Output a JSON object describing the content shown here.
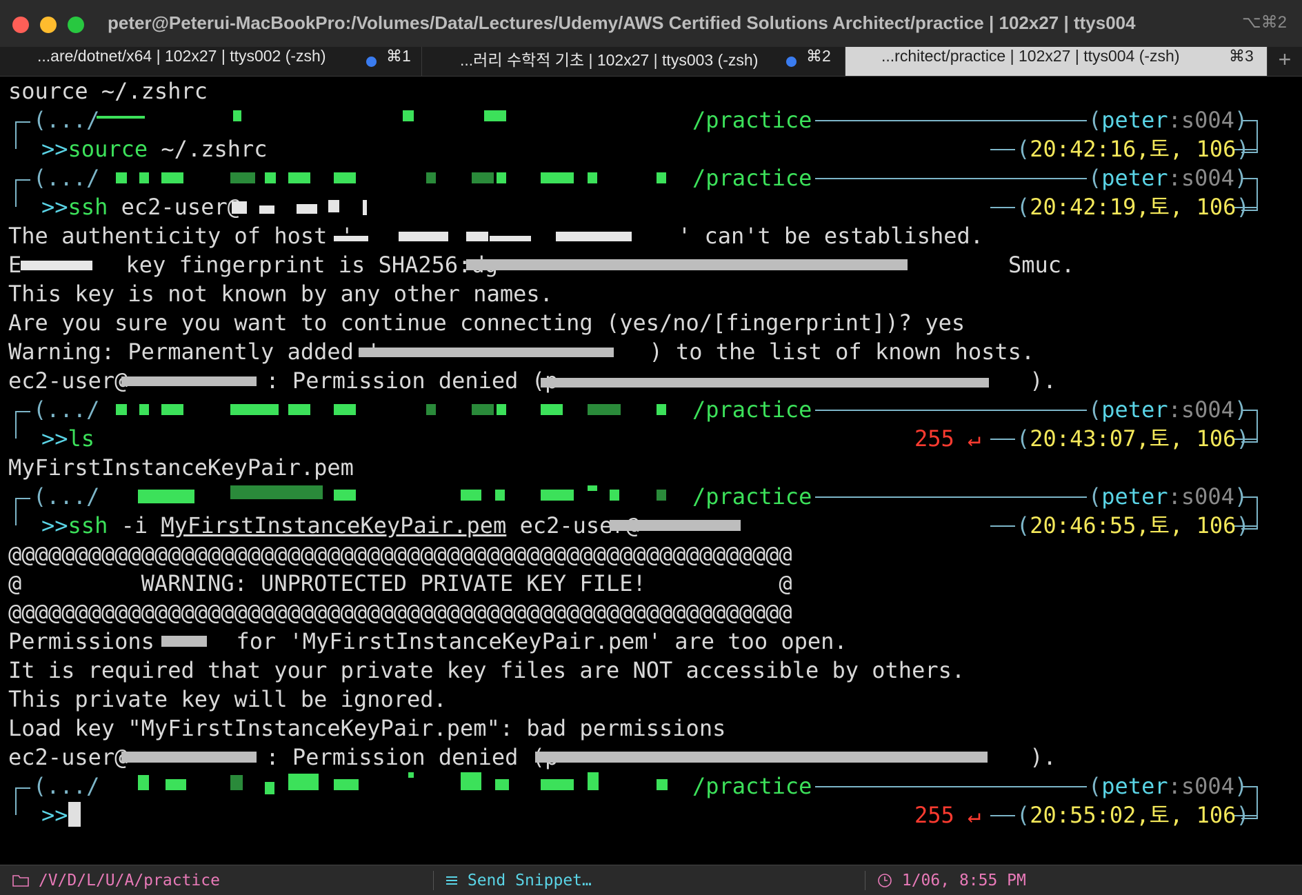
{
  "window": {
    "title": "peter@Peterui-MacBookPro:/Volumes/Data/Lectures/Udemy/AWS Certified Solutions Architect/practice | 102x27 | ttys004",
    "title_shortcut": "⌥⌘2"
  },
  "tabs": [
    {
      "label": "...are/dotnet/x64 | 102x27 | ttys002 (-zsh)",
      "shortcut": "⌘1",
      "active": false
    },
    {
      "label": "...러리 수학적 기초 | 102x27 | ttys003 (-zsh)",
      "shortcut": "⌘2",
      "active": false
    },
    {
      "label": "...rchitect/practice | 102x27 | ttys004 (-zsh)",
      "shortcut": "⌘3",
      "active": true
    }
  ],
  "new_tab_label": "+",
  "terminal": {
    "first_line": "source ~/.zshrc",
    "prompts": [
      {
        "dir_prefix": "(.../",
        "path": "/practice",
        "user": "peter",
        "tty": "s004",
        "cmd_prefix": ">>",
        "cmd": "source",
        "args": " ~/.zshrc",
        "time": "20:42:16",
        "day": "토",
        "num": "106",
        "status": ""
      },
      {
        "dir_prefix": "(.../",
        "path": "/practice",
        "user": "peter",
        "tty": "s004",
        "cmd_prefix": ">>",
        "cmd": "ssh",
        "args": " ec2-user@",
        "time": "20:42:19",
        "day": "토",
        "num": "106",
        "status": ""
      },
      {
        "dir_prefix": "(.../",
        "path": "/practice",
        "user": "peter",
        "tty": "s004",
        "cmd_prefix": ">>",
        "cmd": "ls",
        "args": "",
        "time": "20:43:07",
        "day": "토",
        "num": "106",
        "status": "255 ↵"
      },
      {
        "dir_prefix": "(.../",
        "path": "/practice",
        "user": "peter",
        "tty": "s004",
        "cmd_prefix": ">>",
        "cmd": "ssh",
        "args": " -i ",
        "args_underlined": "MyFirstInstanceKeyPair.pem",
        "args_tail": " ec2-user@",
        "time": "20:46:55",
        "day": "토",
        "num": "106",
        "status": ""
      },
      {
        "dir_prefix": "(.../",
        "path": "/practice",
        "user": "peter",
        "tty": "s004",
        "cmd_prefix": ">>",
        "cmd": "",
        "args": "",
        "time": "20:55:02",
        "day": "토",
        "num": "106",
        "status": "255 ↵"
      }
    ],
    "output1": [
      "The authenticity of host '",
      "' can't be established.",
      "E",
      " key fingerprint is SHA256:dg",
      "Smuc.",
      "This key is not known by any other names.",
      "Are you sure you want to continue connecting (yes/no/[fingerprint])? yes",
      "Warning: Permanently added '",
      ") to the list of known hosts.",
      "ec2-user@",
      ": Permission denied (p",
      ")."
    ],
    "ls_output": "MyFirstInstanceKeyPair.pem",
    "output2": [
      "@@@@@@@@@@@@@@@@@@@@@@@@@@@@@@@@@@@@@@@@@@@@@@@@@@@@@@@@@@@",
      "@         WARNING: UNPROTECTED PRIVATE KEY FILE!          @",
      "@@@@@@@@@@@@@@@@@@@@@@@@@@@@@@@@@@@@@@@@@@@@@@@@@@@@@@@@@@@",
      "Permissions ",
      " for 'MyFirstInstanceKeyPair.pem' are too open.",
      "It is required that your private key files are NOT accessible by others.",
      "This private key will be ignored.",
      "Load key \"MyFirstInstanceKeyPair.pem\": bad permissions",
      "ec2-user@",
      ": Permission denied (p",
      ")."
    ]
  },
  "statusbar": {
    "path": "/V/D/L/U/A/practice",
    "snippet": "Send Snippet…",
    "clock": "1/06, 8:55 PM"
  },
  "colors": {
    "prompt_cyan": "#5ad4e6",
    "path_green": "#3ce15a",
    "time_yellow": "#f4e85a",
    "error_red": "#ff3b30",
    "tab_dot_blue": "#3a7cf0",
    "status_pink": "#e87ab8"
  },
  "icons": [
    "folder-icon",
    "snippet-icon",
    "clock-icon",
    "return-icon"
  ]
}
